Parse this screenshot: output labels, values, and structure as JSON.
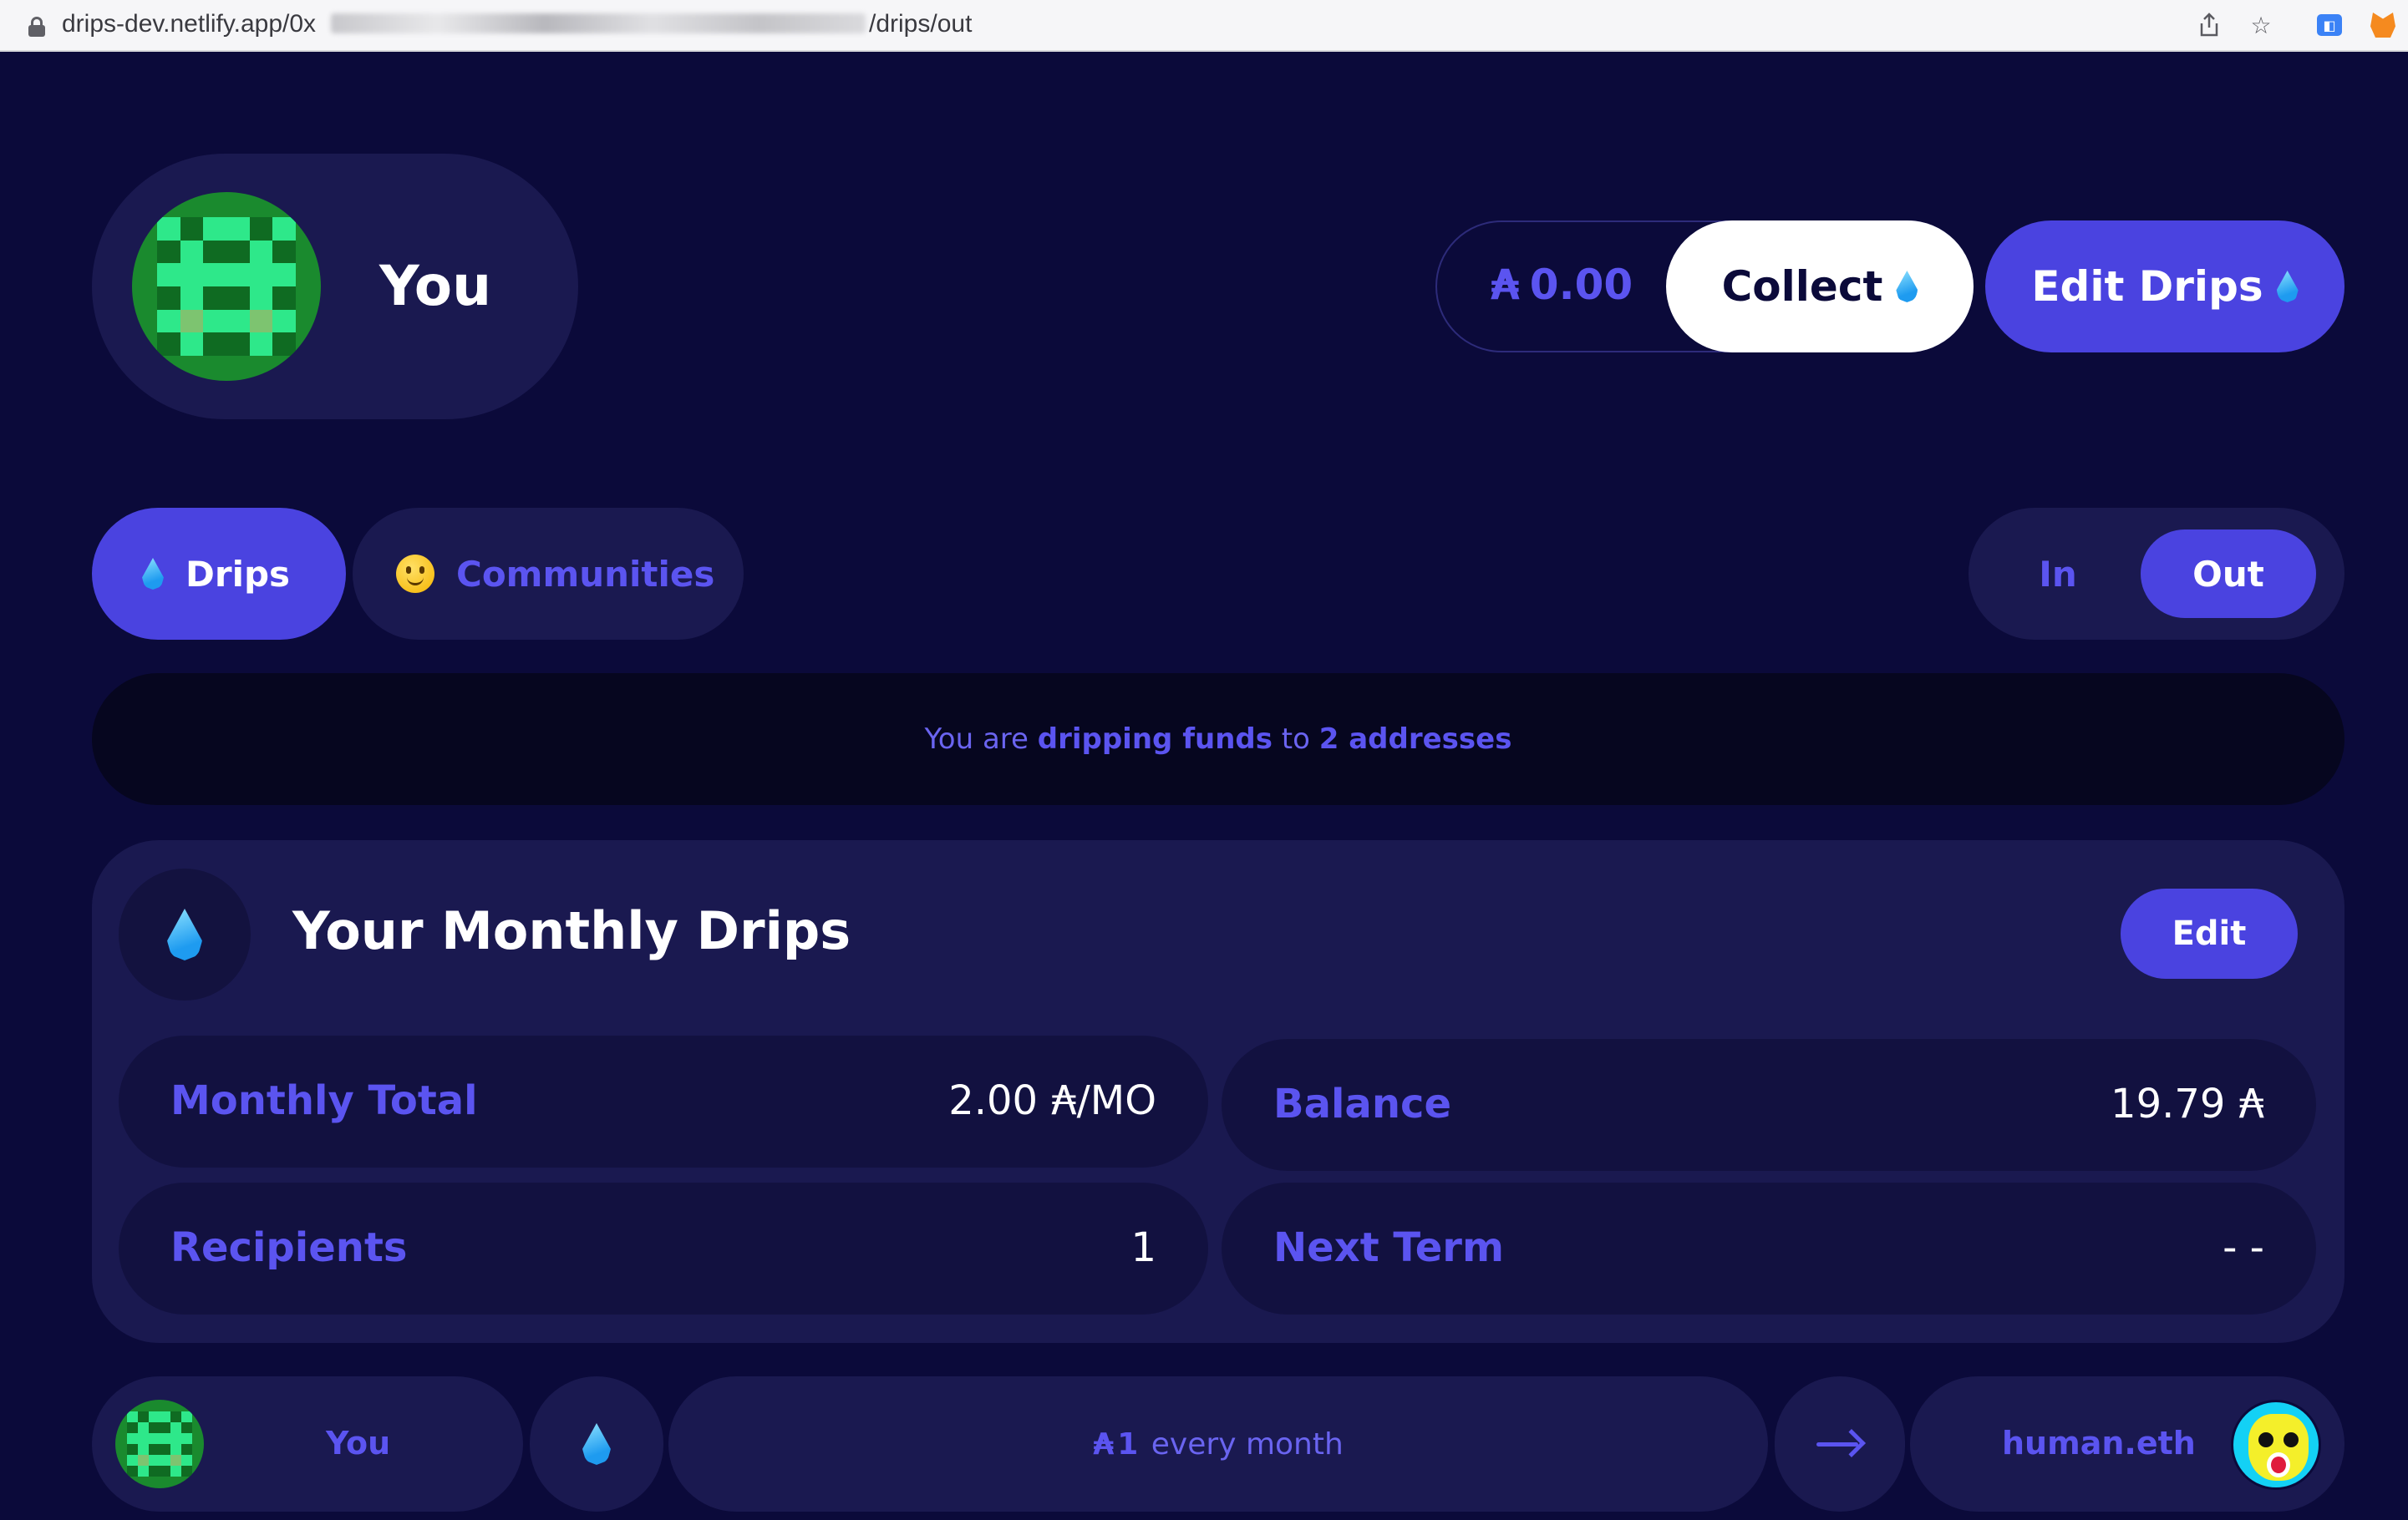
{
  "browser": {
    "url_prefix": "drips-dev.netlify.app/0x",
    "url_suffix": "/drips/out"
  },
  "profile": {
    "name": "You"
  },
  "header": {
    "balance": "0.00",
    "currency_symbol": "₳",
    "collect_label": "Collect",
    "edit_drips_label": "Edit Drips"
  },
  "tabs": [
    {
      "label": "Drips",
      "active": true
    },
    {
      "label": "Communities",
      "active": false
    }
  ],
  "direction_toggle": {
    "in_label": "In",
    "out_label": "Out",
    "selected": "Out"
  },
  "banner": {
    "prefix": "You are ",
    "bold1": "dripping funds",
    "middle": " to ",
    "bold2": "2 addresses"
  },
  "monthly_card": {
    "title": "Your Monthly Drips",
    "edit_label": "Edit",
    "stats": {
      "monthly_total_label": "Monthly Total",
      "monthly_total_value": "2.00",
      "monthly_total_unit": "₳/MO",
      "balance_label": "Balance",
      "balance_value": "19.79",
      "balance_unit": "₳",
      "recipients_label": "Recipients",
      "recipients_value": "1",
      "next_term_label": "Next Term",
      "next_term_value": "- -"
    }
  },
  "drip_row": {
    "from": "You",
    "amount_symbol": "₳",
    "amount": "1",
    "frequency": " every month",
    "to": "human.eth"
  },
  "colors": {
    "background": "#0b0a3a",
    "accent": "#4a43e0",
    "accent_text": "#5b54f0",
    "panel": "#1a1950"
  }
}
